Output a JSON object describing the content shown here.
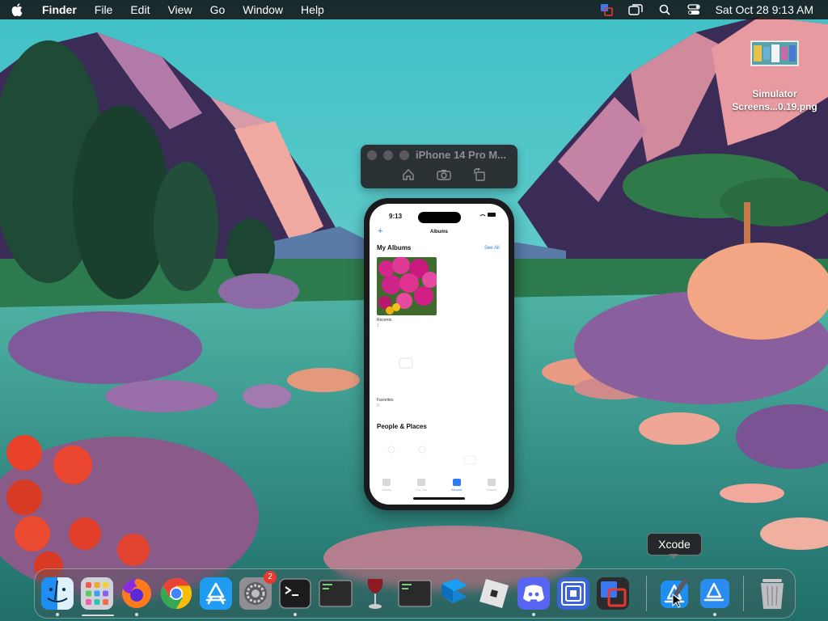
{
  "menubar": {
    "app_name": "Finder",
    "items": [
      "File",
      "Edit",
      "View",
      "Go",
      "Window",
      "Help"
    ],
    "clock": "Sat Oct 28  9:13 AM",
    "status_icons": [
      "screen-mirror-icon",
      "window-icon",
      "search-icon",
      "control-center-icon"
    ]
  },
  "desktop_file": {
    "name_line1": "Simulator",
    "name_line2": "Screens...0.19.png"
  },
  "simulator": {
    "title": "iPhone 14 Pro M...",
    "tools": [
      "home-icon",
      "screenshot-icon",
      "rotate-icon"
    ],
    "screen": {
      "time": "9:13",
      "nav_title": "Albums",
      "plus": "+",
      "my_albums": "My Albums",
      "see_all": "See All",
      "recents_label": "Recents",
      "recents_count": "1",
      "favorites_label": "Favorites",
      "favorites_count": "0",
      "people_places": "People & Places",
      "tabs": [
        "Library",
        "For You",
        "Albums",
        "Search"
      ]
    }
  },
  "tooltip": "Xcode",
  "dock": {
    "apps": [
      {
        "name": "Finder",
        "running": true
      },
      {
        "name": "Launchpad",
        "running": false
      },
      {
        "name": "Firefox",
        "running": true
      },
      {
        "name": "Chrome",
        "running": false
      },
      {
        "name": "App Store",
        "running": false
      },
      {
        "name": "System Settings",
        "running": false,
        "badge": "2"
      },
      {
        "name": "Terminal",
        "running": true
      },
      {
        "name": "Console",
        "running": false
      },
      {
        "name": "Wine",
        "running": false
      },
      {
        "name": "Console 2",
        "running": false
      },
      {
        "name": "Studio",
        "running": false
      },
      {
        "name": "Roblox",
        "running": false
      },
      {
        "name": "Discord",
        "running": true
      },
      {
        "name": "Frame",
        "running": false
      },
      {
        "name": "Mirroring",
        "running": false
      },
      {
        "name": "Xcode",
        "running": false
      },
      {
        "name": "Simulator",
        "running": true
      },
      {
        "name": "Trash",
        "running": false
      }
    ]
  },
  "colors": {
    "accent": "#2f7bf6",
    "badge": "#e8382f"
  }
}
